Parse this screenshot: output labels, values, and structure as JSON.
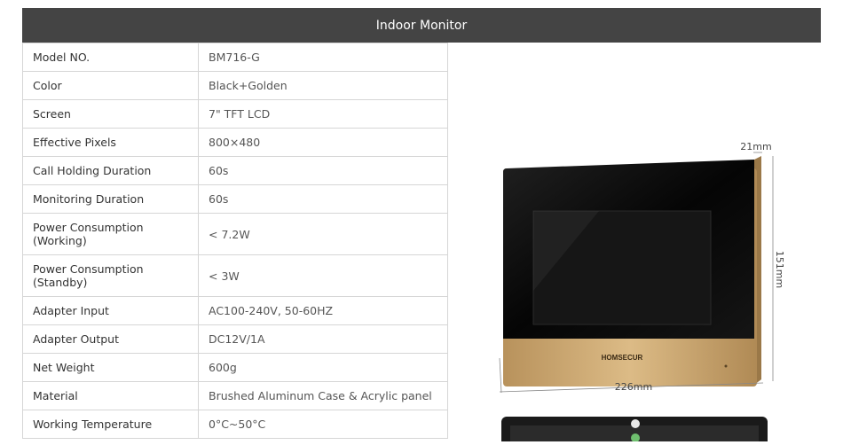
{
  "header": {
    "title": "Indoor Monitor"
  },
  "specs": [
    {
      "label": "Model NO.",
      "value": "BM716-G"
    },
    {
      "label": "Color",
      "value": "Black+Golden"
    },
    {
      "label": "Screen",
      "value": "7\" TFT LCD"
    },
    {
      "label": "Effective Pixels",
      "value": "800×480"
    },
    {
      "label": "Call Holding Duration",
      "value": "60s"
    },
    {
      "label": "Monitoring Duration",
      "value": "60s"
    },
    {
      "label": "Power Consumption (Working)",
      "value": "< 7.2W"
    },
    {
      "label": "Power Consumption (Standby)",
      "value": "< 3W"
    },
    {
      "label": "Adapter Input",
      "value": "AC100-240V, 50-60HZ"
    },
    {
      "label": "Adapter Output",
      "value": "DC12V/1A"
    },
    {
      "label": "Net Weight",
      "value": "600g"
    },
    {
      "label": "Material",
      "value": "Brushed Aluminum Case & Acrylic panel"
    },
    {
      "label": "Working Temperature",
      "value": "0°C~50°C"
    }
  ],
  "product": {
    "brand": "HOMSECUR",
    "dim_depth": "21mm",
    "dim_height": "151mm",
    "dim_width": "226mm",
    "frame_color": "#c9a36b",
    "screen_color": "#0a0a0a"
  }
}
